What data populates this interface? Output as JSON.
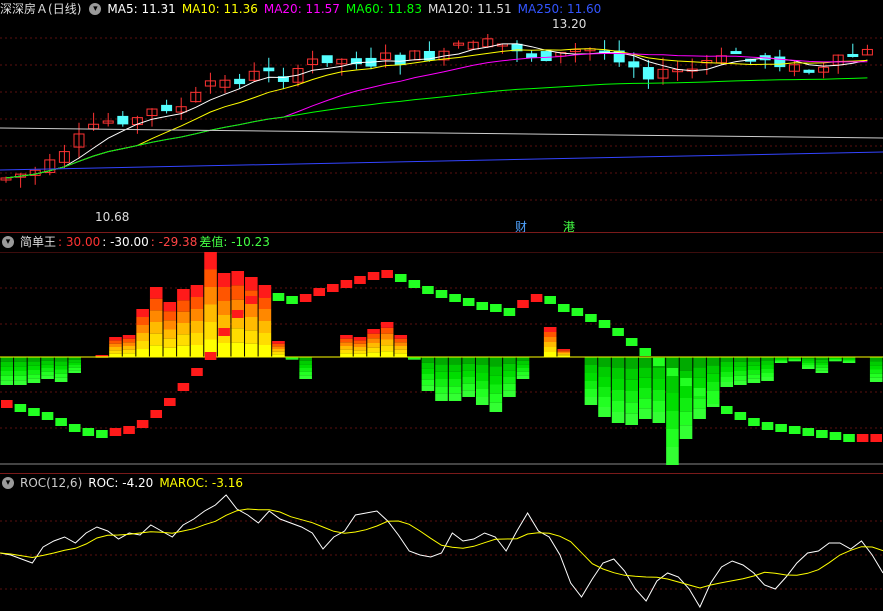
{
  "main": {
    "stock_name": "深深房Ａ",
    "period": "(日线)",
    "ma": [
      {
        "label": "MA5: 11.31",
        "color": "#ffffff"
      },
      {
        "label": "MA10: 11.36",
        "color": "#ffff00"
      },
      {
        "label": "MA20: 11.57",
        "color": "#ff00ff"
      },
      {
        "label": "MA60: 11.83",
        "color": "#00ff00"
      },
      {
        "label": "MA120: 11.51",
        "color": "#dddddd"
      },
      {
        "label": "MA250: 11.60",
        "color": "#3355ff"
      }
    ],
    "high_label": "13.20",
    "low_label": "10.68",
    "tag_cai": "财",
    "tag_gang": "港",
    "up_color": "#ff3333",
    "down_color": "#55ffff"
  },
  "indicator1": {
    "name": "简单王",
    "v1": ": 30.00",
    "v2": ": -30.00",
    "v3": ": -29.38",
    "diff_label": "差值",
    "diff_value": ": -10.23"
  },
  "indicator2": {
    "name": "ROC(12,6)",
    "roc": "ROC: -4.20",
    "maroc": "MAROC: -3.16"
  }
}
